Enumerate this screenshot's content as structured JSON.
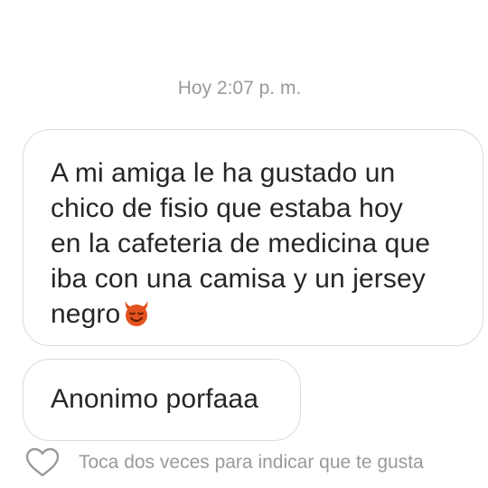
{
  "thread": {
    "timestamp": "Hoy 2:07 p. m.",
    "messages": [
      {
        "lines": [
          "A mi amiga le ha gustado un",
          "chico de fisio que estaba hoy",
          "en la cafeteria de medicina que",
          "iba con una camisa y un jersey",
          "negro"
        ],
        "emoji": "smiling-devil-emoji"
      },
      {
        "text": "Anonimo porfaaa"
      }
    ],
    "like_hint": "Toca dos veces para indicar que te gusta",
    "like_icon": "heart-outline-icon"
  },
  "colors": {
    "text": "#262626",
    "muted": "#9a9a9a",
    "bubble_border": "#dbdbdb",
    "emoji_fill": "#e2511e"
  }
}
